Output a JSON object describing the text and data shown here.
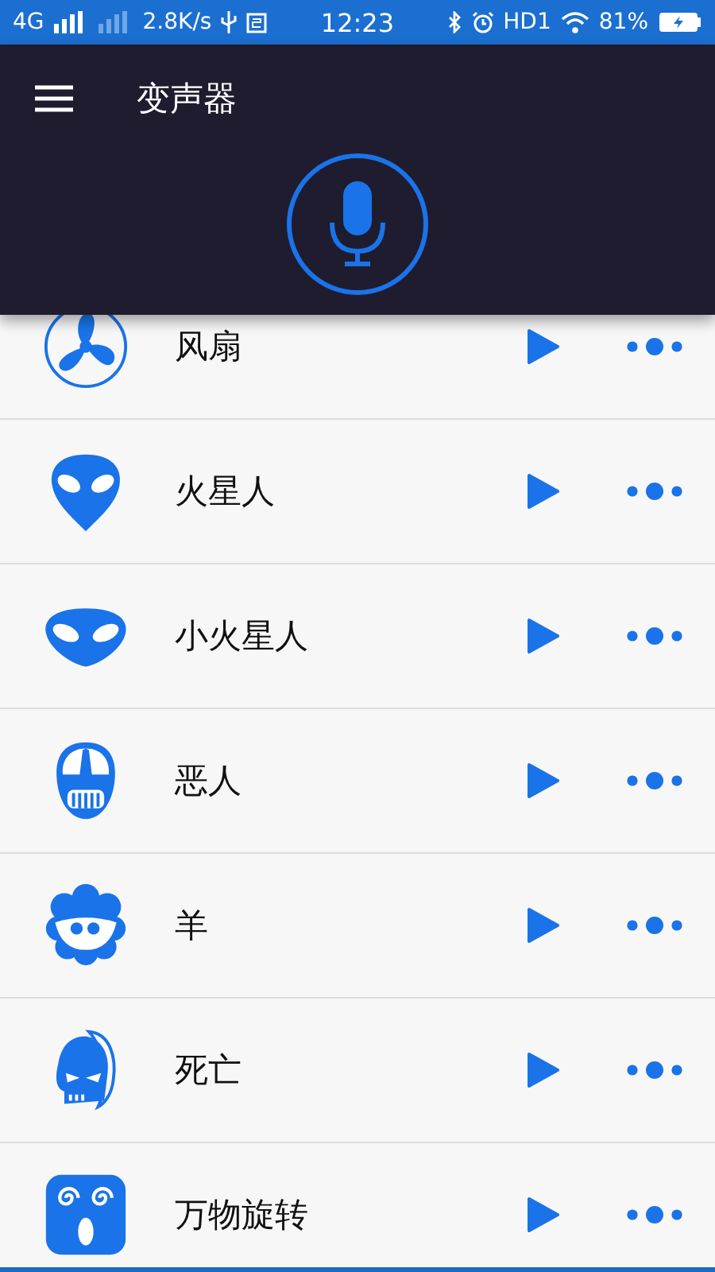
{
  "status_bar": {
    "network": "4G",
    "speed": "2.8K/s",
    "time": "12:23",
    "hd": "HD1",
    "battery": "81%"
  },
  "app_bar": {
    "title": "变声器"
  },
  "effects": [
    {
      "name": "风扇",
      "kind": "fan"
    },
    {
      "name": "火星人",
      "kind": "alien"
    },
    {
      "name": "小火星人",
      "kind": "alien-wide"
    },
    {
      "name": "恶人",
      "kind": "villain"
    },
    {
      "name": "羊",
      "kind": "sheep"
    },
    {
      "name": "死亡",
      "kind": "reaper"
    },
    {
      "name": "万物旋转",
      "kind": "spiral"
    }
  ]
}
